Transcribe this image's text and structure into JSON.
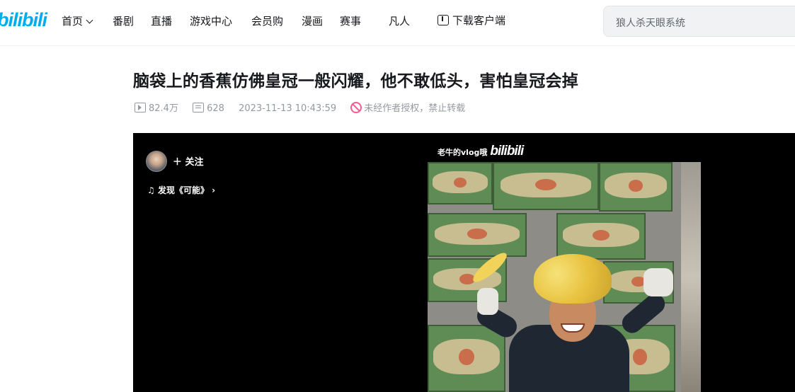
{
  "header": {
    "logo": "bilibili",
    "nav": [
      {
        "label": "首页",
        "has_dropdown": true
      },
      {
        "label": "番剧"
      },
      {
        "label": "直播"
      },
      {
        "label": "游戏中心"
      },
      {
        "label": "会员购"
      },
      {
        "label": "漫画"
      },
      {
        "label": "赛事"
      },
      {
        "label": "凡人"
      }
    ],
    "download_label": "下载客户端",
    "search_placeholder": "狼人杀天眼系统"
  },
  "video": {
    "title": "脑袋上的香蕉仿佛皇冠一般闪耀，他不敢低头，害怕皇冠会掉",
    "views": "82.4万",
    "danmaku": "628",
    "date": "2023-11-13 10:43:59",
    "copyright_notice": "未经作者授权，禁止转载"
  },
  "player": {
    "follow_label": "关注",
    "music_label": "发现《可能》",
    "watermark_text": "老牛的vlog哦",
    "watermark_logo": "bilibili"
  },
  "colors": {
    "brand": "#00aeec",
    "warning": "#f25d8e",
    "muted": "#9499a0"
  }
}
